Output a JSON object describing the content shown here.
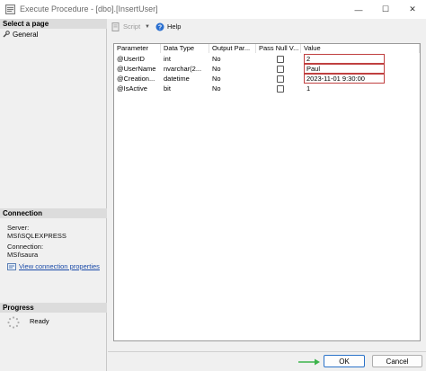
{
  "window": {
    "title": "Execute Procedure - [dbo].[InsertUser]",
    "minimize": "—",
    "maximize": "☐",
    "close": "✕"
  },
  "sidebar": {
    "select_page_header": "Select a page",
    "items": [
      {
        "label": "General",
        "icon": "wrench-icon"
      }
    ],
    "connection_header": "Connection",
    "server_label": "Server:",
    "server_value": "MSI\\SQLEXPRESS",
    "connection_label": "Connection:",
    "connection_value": "MSI\\saura",
    "view_link": "View connection properties",
    "progress_header": "Progress",
    "progress_status": "Ready"
  },
  "toolbar": {
    "script_label": "Script",
    "help_label": "Help"
  },
  "grid": {
    "columns": [
      "Parameter",
      "Data Type",
      "Output Par...",
      "Pass Null V...",
      "Value"
    ],
    "rows": [
      {
        "parameter": "@UserID",
        "data_type": "int",
        "output": "No",
        "value": "2"
      },
      {
        "parameter": "@UserName",
        "data_type": "nvarchar(2...",
        "output": "No",
        "value": "Paul"
      },
      {
        "parameter": "@Creation...",
        "data_type": "datetime",
        "output": "No",
        "value": "2023-11-01 9:30:00"
      },
      {
        "parameter": "@IsActive",
        "data_type": "bit",
        "output": "No",
        "value": "1"
      }
    ]
  },
  "footer": {
    "ok_label": "OK",
    "cancel_label": "Cancel"
  },
  "colors": {
    "value_highlight": "#c04040",
    "arrow": "#3cb44b",
    "link": "#1a4aa8"
  }
}
